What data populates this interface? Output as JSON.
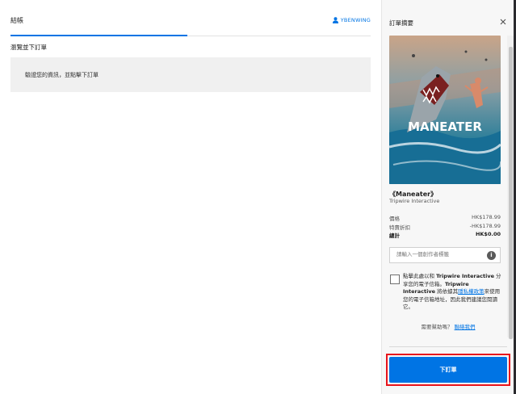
{
  "left": {
    "tab_label": "結帳",
    "username": "YBENWING",
    "review_heading": "瀏覽並下訂單",
    "info_message": "驗證您的資訊，並點擊下訂單"
  },
  "summary": {
    "title": "訂單摘要",
    "game_title": "《Maneater》",
    "publisher": "Tripwire Interactive",
    "cover_logo": "MANEATER",
    "price_label": "價格",
    "price_value": "HK$178.99",
    "discount_label": "特賣折扣",
    "discount_value": "-HK$178.99",
    "total_label": "總計",
    "total_value": "HK$0.00",
    "creator_placeholder": "請輸入一個創作者標籤",
    "consent": {
      "p1": "點擊此處以和 ",
      "company1": "Tripwire Interactive",
      "p2": " 分享您的電子信箱。",
      "company2": "Tripwire Interactive",
      "p3": " 將依據其",
      "policy_link": "隱私權政策",
      "p4": "來使用您的電子信箱地址，因此我們建議您閱讀它。"
    },
    "help_text": "需要幫助嗎？",
    "contact_link": "聯絡我們",
    "order_button": "下訂單"
  },
  "colors": {
    "accent": "#0074e4",
    "highlight": "#e8141c",
    "panel": "#f7f7f7"
  }
}
